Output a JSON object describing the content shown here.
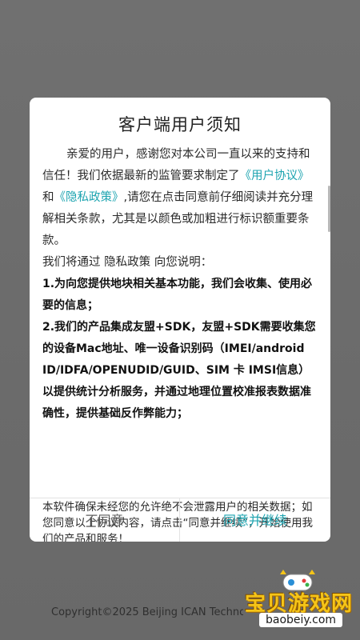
{
  "dialog": {
    "title": "客户端用户须知",
    "intro": {
      "part1": "亲爱的用户，感谢您对本公司一直以来的支持和信任！我们依据最新的监管要求制定了",
      "link_user_agreement": "《用户协议》",
      "part2": "和",
      "link_privacy_policy": "《隐私政策》",
      "part3": ",请您在点击同意前仔细阅读并充分理解相关条款，尤其是以颜色或加粗进行标识额重要条款。"
    },
    "explain_line": "我们将通过 隐私政策 向您说明：",
    "point1": "1.为向您提供地块相关基本功能，我们会收集、使用必要的信息；",
    "point2": "2.我们的产品集成友盟+SDK，友盟+SDK需要收集您的设备Mac地址、唯一设备识别码（IMEI/android ID/IDFA/OPENUDID/GUID、SIM 卡 IMSI信息）以提供统计分析服务，并通过地理位置校准报表数据准确性，提供基础反作弊能力；",
    "note": "本软件确保未经您的允许绝不会泄露用户的相关数据；如您同意以上协议内容，请点击“同意并继续”，开始使用我们的产品和服务！",
    "buttons": {
      "disagree": "不同意",
      "agree": "同意并继续"
    }
  },
  "footer": {
    "copyright": "Copyright©2025 Beijing ICAN Techno"
  },
  "watermark": {
    "name": "宝贝游戏网",
    "url": "baobeiy.com"
  },
  "colors": {
    "accent": "#1da4b0",
    "backdrop": "#6e6e6e"
  }
}
